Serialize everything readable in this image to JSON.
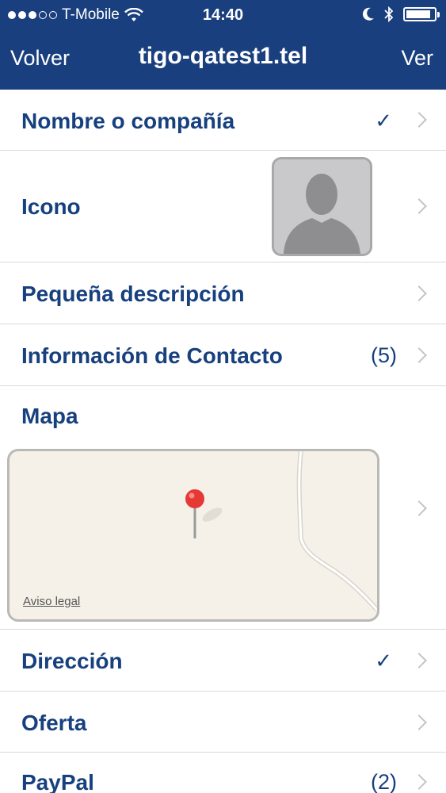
{
  "status_bar": {
    "carrier": "T-Mobile",
    "time": "14:40"
  },
  "nav": {
    "back_label": "Volver",
    "title": "tigo-qatest1.tel",
    "right_label": "Ver"
  },
  "rows": {
    "name": {
      "label": "Nombre o compañía",
      "check": "✓"
    },
    "icon": {
      "label": "Icono"
    },
    "short_desc": {
      "label": "Pequeña descripción"
    },
    "contact": {
      "label": "Información de Contacto",
      "count": "(5)"
    },
    "map": {
      "label": "Mapa",
      "legal": "Aviso legal"
    },
    "address": {
      "label": "Dirección",
      "check": "✓"
    },
    "offer": {
      "label": "Oferta"
    },
    "paypal": {
      "label": "PayPal",
      "count": "(2)"
    }
  },
  "colors": {
    "nav_bg": "#1a3f7e",
    "label_text": "#17407e",
    "map_pin": "#e53935"
  }
}
